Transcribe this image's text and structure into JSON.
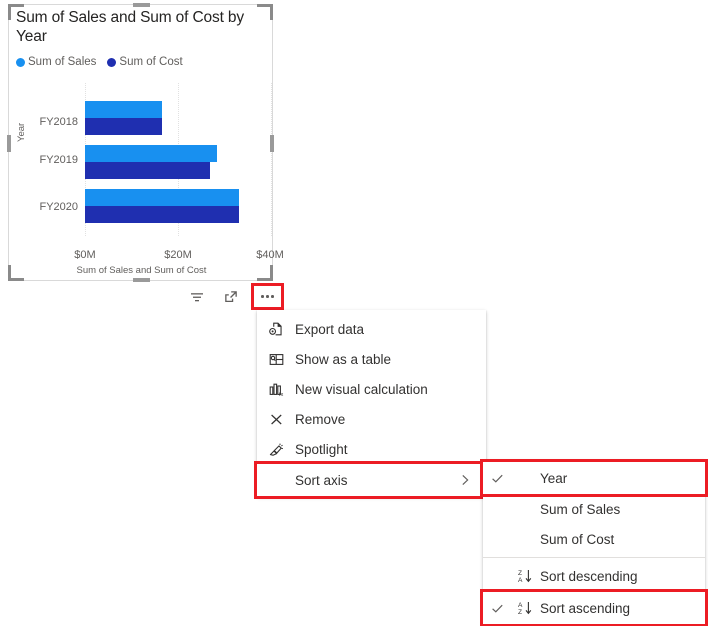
{
  "visual": {
    "title": "Sum of Sales and Sum of Cost by Year",
    "toolbar": {
      "filter_label": "Filters",
      "focus_label": "Focus mode",
      "more_options_label": "More options"
    }
  },
  "chart_data": {
    "type": "bar",
    "title": "Sum of Sales and Sum of Cost by Year",
    "orientation": "horizontal",
    "categories": [
      "FY2018",
      "FY2019",
      "FY2020"
    ],
    "series": [
      {
        "name": "Sum of Sales",
        "color": "#1890f0",
        "values": [
          16.5,
          28.5,
          33.0
        ]
      },
      {
        "name": "Sum of Cost",
        "color": "#1f2fb0",
        "values": [
          16.5,
          27.0,
          33.0
        ]
      }
    ],
    "xlabel": "Sum of Sales and Sum of Cost",
    "ylabel": "Year",
    "xticks": [
      "$0M",
      "$20M",
      "$40M"
    ],
    "xtick_values": [
      0,
      20,
      40
    ],
    "xlim": [
      0,
      40
    ],
    "grid": true,
    "legend": {
      "position": "top-left",
      "entries": [
        {
          "label": "Sum of Sales",
          "color": "#1890f0"
        },
        {
          "label": "Sum of Cost",
          "color": "#1f2fb0"
        }
      ]
    }
  },
  "context_menu": {
    "items": [
      {
        "icon": "export-data-icon",
        "label": "Export data",
        "submenu": false
      },
      {
        "icon": "show-as-table-icon",
        "label": "Show as a table",
        "submenu": false
      },
      {
        "icon": "new-visual-calculation-icon",
        "label": "New visual calculation",
        "submenu": false
      },
      {
        "icon": "remove-icon",
        "label": "Remove",
        "submenu": false
      },
      {
        "icon": "spotlight-icon",
        "label": "Spotlight",
        "submenu": false
      },
      {
        "icon": "",
        "label": "Sort axis",
        "submenu": true
      }
    ]
  },
  "sort_submenu": {
    "fields": [
      {
        "label": "Year",
        "checked": true
      },
      {
        "label": "Sum of Sales",
        "checked": false
      },
      {
        "label": "Sum of Cost",
        "checked": false
      }
    ],
    "directions": [
      {
        "label": "Sort descending",
        "checked": false,
        "glyph": "sort-descending-icon"
      },
      {
        "label": "Sort ascending",
        "checked": true,
        "glyph": "sort-ascending-icon"
      }
    ]
  },
  "highlight_color": "#ec1c24"
}
